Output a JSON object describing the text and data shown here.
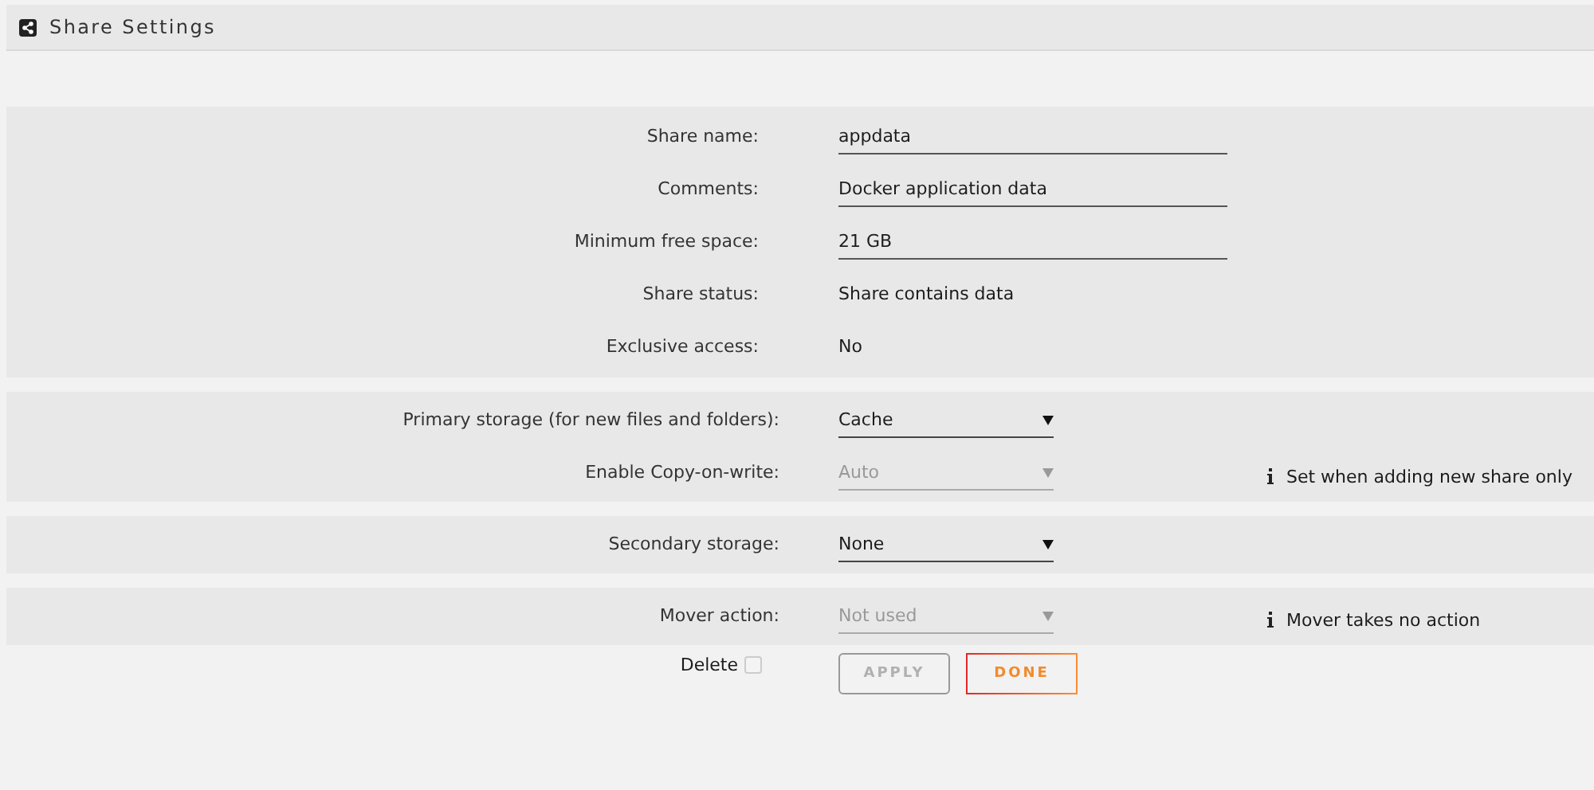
{
  "header": {
    "title": "Share Settings"
  },
  "sections": [
    {
      "rows": [
        {
          "kind": "input",
          "label": "Share name:",
          "value": "appdata"
        },
        {
          "kind": "input",
          "label": "Comments:",
          "value": "Docker application data"
        },
        {
          "kind": "input",
          "label": "Minimum free space:",
          "value": "21 GB"
        },
        {
          "kind": "text",
          "label": "Share status:",
          "value": "Share contains data"
        },
        {
          "kind": "text",
          "label": "Exclusive access:",
          "value": "No"
        }
      ]
    },
    {
      "rows": [
        {
          "kind": "select",
          "label": "Primary storage (for new files and folders):",
          "value": "Cache",
          "disabled": false
        },
        {
          "kind": "select",
          "label": "Enable Copy-on-write:",
          "value": "Auto",
          "disabled": true,
          "note": "Set when adding new share only"
        }
      ]
    },
    {
      "rows": [
        {
          "kind": "select",
          "label": "Secondary storage:",
          "value": "None",
          "disabled": false
        }
      ]
    },
    {
      "rows": [
        {
          "kind": "select",
          "label": "Mover action:",
          "value": "Not used",
          "disabled": true,
          "note": "Mover takes no action"
        }
      ]
    }
  ],
  "delete": {
    "label": "Delete",
    "checked": false
  },
  "buttons": [
    {
      "label": "APPLY",
      "disabled": true
    },
    {
      "label": "DONE",
      "disabled": false
    }
  ]
}
